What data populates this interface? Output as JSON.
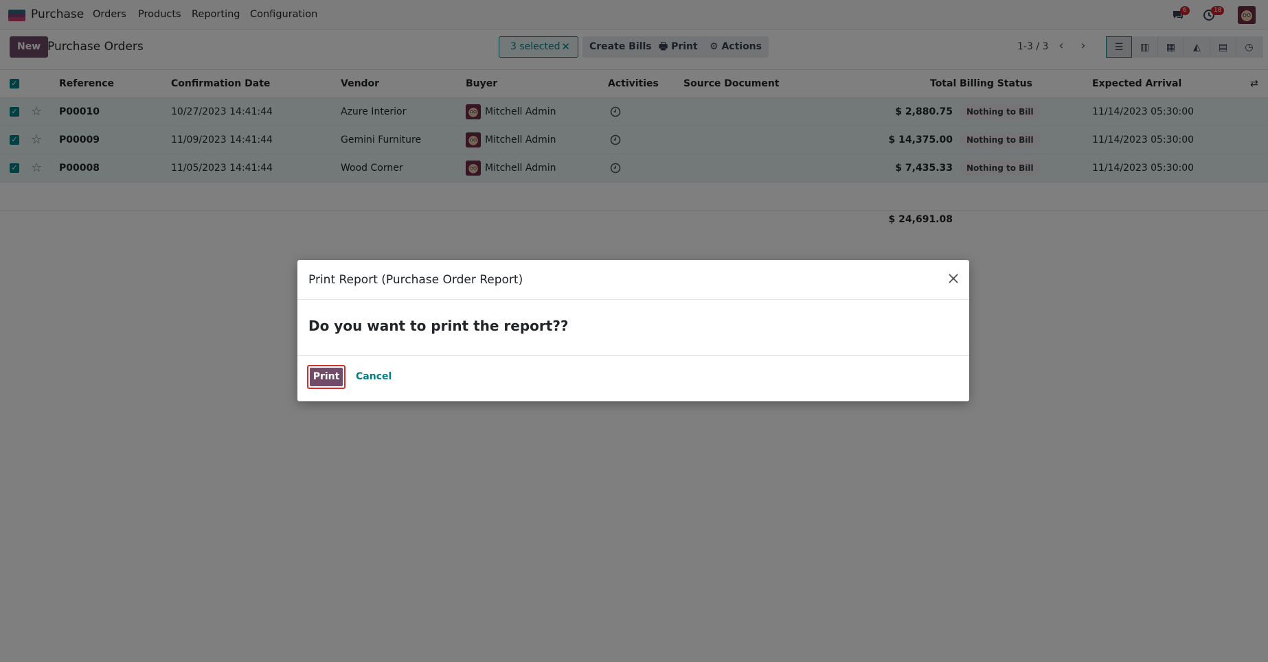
{
  "app": {
    "name": "Purchase",
    "menu": [
      "Orders",
      "Products",
      "Reporting",
      "Configuration"
    ],
    "messages_badge": "6",
    "activities_badge": "18"
  },
  "control_panel": {
    "new_label": "New",
    "breadcrumb": "Purchase Orders",
    "selected_label": "3 selected",
    "clear_selection_glyph": "✕",
    "create_bills_label": "Create Bills",
    "print_label": "Print",
    "actions_label": "Actions",
    "pager": "1-3 / 3",
    "views": [
      "list",
      "kanban",
      "pivot",
      "graph",
      "calendar",
      "activity"
    ],
    "active_view": "list"
  },
  "table": {
    "columns": [
      "Reference",
      "Confirmation Date",
      "Vendor",
      "Buyer",
      "Activities",
      "Source Document",
      "Total",
      "Billing Status",
      "Expected Arrival"
    ],
    "rows": [
      {
        "reference": "P00010",
        "confirmation_date": "10/27/2023 14:41:44",
        "vendor": "Azure Interior",
        "buyer": "Mitchell Admin",
        "source_document": "",
        "total": "$ 2,880.75",
        "billing_status": "Nothing to Bill",
        "expected_arrival": "11/14/2023 05:30:00"
      },
      {
        "reference": "P00009",
        "confirmation_date": "11/09/2023 14:41:44",
        "vendor": "Gemini Furniture",
        "buyer": "Mitchell Admin",
        "source_document": "",
        "total": "$ 14,375.00",
        "billing_status": "Nothing to Bill",
        "expected_arrival": "11/14/2023 05:30:00"
      },
      {
        "reference": "P00008",
        "confirmation_date": "11/05/2023 14:41:44",
        "vendor": "Wood Corner",
        "buyer": "Mitchell Admin",
        "source_document": "",
        "total": "$ 7,435.33",
        "billing_status": "Nothing to Bill",
        "expected_arrival": "11/14/2023 05:30:00"
      }
    ],
    "grand_total": "$ 24,691.08"
  },
  "dialog": {
    "title": "Print Report (Purchase Order Report)",
    "question": "Do you want to print the report??",
    "print_label": "Print",
    "cancel_label": "Cancel"
  },
  "colors": {
    "brand": "#714b67",
    "accent": "#017e84",
    "selected_row": "#e6f2f3",
    "highlight_border": "#d32f2f"
  }
}
